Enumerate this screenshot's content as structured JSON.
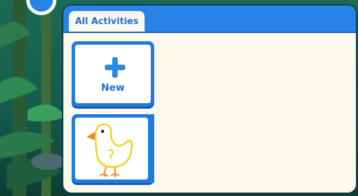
{
  "tabs": {
    "active_label": "All Activities"
  },
  "new_card": {
    "label": "New",
    "icon": "plus-icon"
  },
  "projects": [
    {
      "thumbnail": "chick-drawing",
      "thumbnail_color": "#f2d21a"
    }
  ],
  "colors": {
    "accent": "#2783e8",
    "panel": "#fbf8ec",
    "label_text": "#1f6ed4"
  }
}
